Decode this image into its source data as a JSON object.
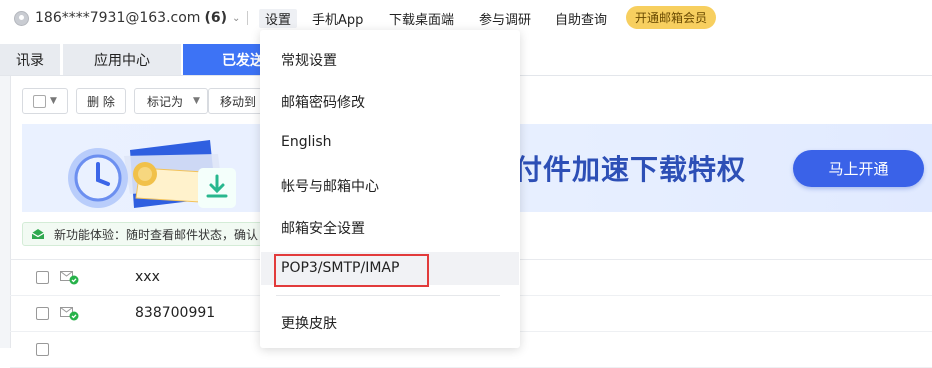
{
  "header": {
    "account_email": "186****7931@163.com",
    "account_count": "(6)",
    "menu": [
      "设置",
      "手机App",
      "下载桌面端",
      "参与调研",
      "自助查询"
    ],
    "vip_button": "开通邮箱会员"
  },
  "tabs": [
    "讯录",
    "应用中心",
    "已发送"
  ],
  "toolbar": {
    "delete": "删 除",
    "mark_as": "标记为",
    "move_to": "移动到"
  },
  "banner": {
    "text": "付件加速下载特权",
    "button": "马上开通"
  },
  "notice": {
    "text": "新功能体验：随时查看邮件状态，确认"
  },
  "mail_rows": [
    {
      "subject": "xxx"
    },
    {
      "subject": "838700991"
    },
    {
      "subject": ""
    }
  ],
  "settings_menu": {
    "items": [
      "常规设置",
      "邮箱密码修改",
      "English",
      "帐号与邮箱中心",
      "邮箱安全设置",
      "POP3/SMTP/IMAP",
      "更换皮肤"
    ],
    "highlighted_item": "POP3/SMTP/IMAP"
  },
  "colors": {
    "accent": "#3d73f5",
    "vip": "#f7cf5f",
    "highlight_border": "#e23b3b",
    "banner_button": "#3a62e8"
  }
}
